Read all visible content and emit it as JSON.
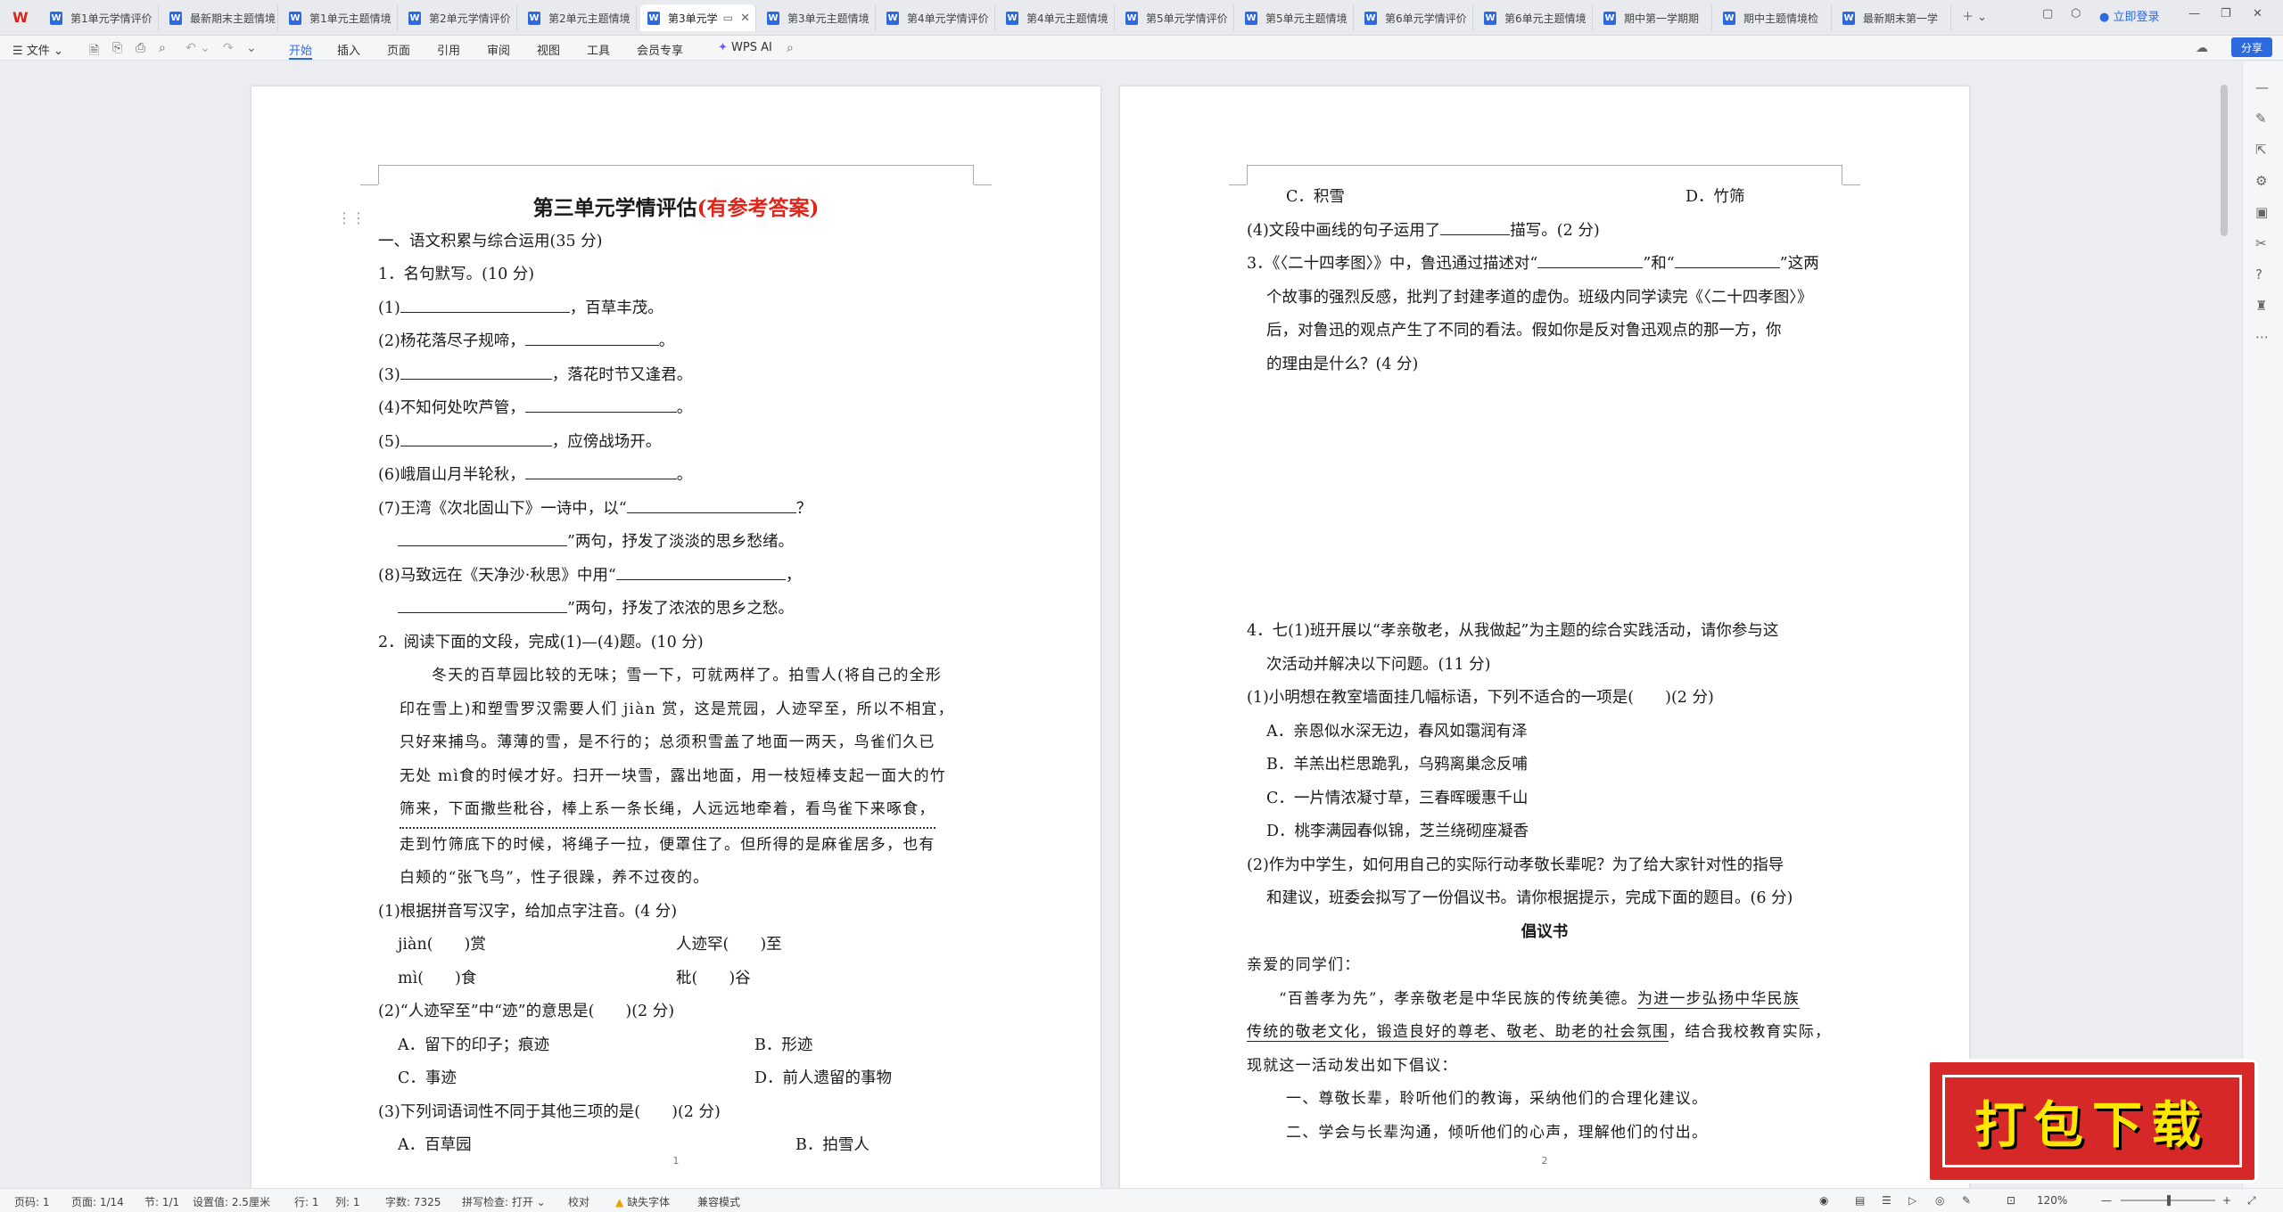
{
  "tabs": [
    {
      "label": "第1单元学情评价"
    },
    {
      "label": "最新期末主题情境"
    },
    {
      "label": "第1单元主题情境"
    },
    {
      "label": "第2单元学情评价"
    },
    {
      "label": "第2单元主题情境"
    },
    {
      "label": "第3单元学",
      "active": true
    },
    {
      "label": "第3单元主题情境"
    },
    {
      "label": "第4单元学情评价"
    },
    {
      "label": "第4单元主题情境"
    },
    {
      "label": "第5单元学情评价"
    },
    {
      "label": "第5单元主题情境"
    },
    {
      "label": "第6单元学情评价"
    },
    {
      "label": "第6单元主题情境"
    },
    {
      "label": "期中第一学期期"
    },
    {
      "label": "期中主题情境检"
    },
    {
      "label": "最新期末第一学"
    }
  ],
  "tabbar": {
    "login": "立即登录"
  },
  "menu": {
    "file": "文件",
    "items": [
      "开始",
      "插入",
      "页面",
      "引用",
      "审阅",
      "视图",
      "工具",
      "会员专享"
    ],
    "wps_ai": "WPS AI",
    "share": "分享"
  },
  "page1": {
    "title_black": "第三单元学情评估",
    "title_red": "(有参考答案)",
    "section1": "一、语文积累与综合运用(35 分)",
    "q1": "1．名句默写。(10 分)",
    "q1_items": [
      {
        "pre": "(1)",
        "post": "，百草丰茂。",
        "blank": 190,
        "blankFirst": true
      },
      {
        "pre": "(2)杨花落尽子规啼，",
        "post": "。",
        "blank": 150
      },
      {
        "pre": "(3)",
        "post": "，落花时节又逢君。",
        "blank": 170,
        "blankFirst": true
      },
      {
        "pre": "(4)不知何处吹芦管，",
        "post": "。",
        "blank": 170
      },
      {
        "pre": "(5)",
        "post": "，应傍战场开。",
        "blank": 170,
        "blankFirst": true
      },
      {
        "pre": "(6)峨眉山月半轮秋，",
        "post": "。",
        "blank": 170
      }
    ],
    "q1_7a": "(7)王湾《次北固山下》一诗中，以“",
    "q1_7b": "？",
    "q1_7c": "”两句，抒发了淡淡的思乡愁绪。",
    "q1_8a": "(8)马致远在《天净沙·秋思》中用“",
    "q1_8b": "，",
    "q1_8c": "”两句，抒发了浓浓的思乡之愁。",
    "q2": "2．阅读下面的文段，完成(1)—(4)题。(10 分)",
    "passage": [
      "冬天的百草园比较的无味；雪一下，可就两样了。拍雪人(将自己的全形",
      "印在雪上)和塑雪罗汉需要人们 jiàn 赏，这是荒园，人迹罕至，所以不相宜，",
      "只好来捕鸟。薄薄的雪，是不行的；总须积雪盖了地面一两天，鸟雀们久已",
      "无处 mì食的时候才好。扫开一块雪，露出地面，用一枝短棒支起一面大的竹",
      "筛来，下面撒些秕谷，棒上系一条长绳，人远远地牵着，看鸟雀下来啄食，",
      "走到竹筛底下的时候，将绳子一拉，便罩住了。但所得的是麻雀居多，也有",
      "白颊的“张飞鸟”，性子很躁，养不过夜的。"
    ],
    "q2_1": "(1)根据拼音写汉字，给加点字注音。(4 分)",
    "q2_1_a": "jiàn(　　)赏",
    "q2_1_b": "人迹罕(　　)至",
    "q2_1_c": "mì(　　)食",
    "q2_1_d": "秕(　　)谷",
    "q2_2": "(2)“人迹罕至”中“迹”的意思是(　　)(2 分)",
    "q2_2_A": "A．留下的印子；痕迹",
    "q2_2_B": "B．形迹",
    "q2_2_C": "C．事迹",
    "q2_2_D": "D．前人遗留的事物",
    "q2_3": "(3)下列词语词性不同于其他三项的是(　　)(2 分)",
    "q2_3_A": "A．百草园",
    "q2_3_B": "B．拍雪人",
    "page_number": "1"
  },
  "page2": {
    "opt_C": "C．积雪",
    "opt_D": "D．竹筛",
    "q2_4a": "(4)文段中画线的句子运用了",
    "q2_4b": "描写。(2 分)",
    "q3_l1a": "3．《〈二十四孝图〉》中，鲁迅通过描述对“",
    "q3_l1b": "”和“",
    "q3_l1c": "”这两",
    "q3_l2": "个故事的强烈反感，批判了封建孝道的虚伪。班级内同学读完《〈二十四孝图〉》",
    "q3_l3": "后，对鲁迅的观点产生了不同的看法。假如你是反对鲁迅观点的那一方，你",
    "q3_l4": "的理由是什么？(4 分)",
    "q4_l1": "4．七(1)班开展以“孝亲敬老，从我做起”为主题的综合实践活动，请你参与这",
    "q4_l2": "次活动并解决以下问题。(11 分)",
    "q4_1": "(1)小明想在教室墙面挂几幅标语，下列不适合的一项是(　　)(2 分)",
    "q4_1_opts": [
      "A．亲恩似水深无边，春风如霭润有泽",
      "B．羊羔出栏思跪乳，乌鸦离巢念反哺",
      "C．一片情浓凝寸草，三春晖暖惠千山",
      "D．桃李满园春似锦，芝兰绕砌座凝香"
    ],
    "q4_2_l1": "(2)作为中学生，如何用自己的实际行动孝敬长辈呢？为了给大家针对性的指导",
    "q4_2_l2": "和建议，班委会拟写了一份倡议书。请你根据提示，完成下面的题目。(6 分)",
    "letter_title": "倡议书",
    "salutation": "亲爱的同学们：",
    "letter_l1a": "“百善孝为先”，孝亲敬老是中华民族的传统美德。",
    "letter_l1b": "为进一步弘扬中华民族",
    "letter_l2a": "传统的敬老文化，锻造良好的尊老、敬老、助老的社会氛围",
    "letter_l2b": "，结合我校教育实际，",
    "letter_l3": "现就这一活动发出如下倡议：",
    "letter_l4": "一、尊敬长辈，聆听他们的教诲，采纳他们的合理化建议。",
    "letter_l5": "二、学会与长辈沟通，倾听他们的心声，理解他们的付出。",
    "page_number": "2"
  },
  "status": {
    "page": "页码: 1",
    "pages": "页面: 1/14",
    "section": "节: 1/1",
    "setting": "设置值: 2.5厘米",
    "row": "行: 1",
    "col": "列: 1",
    "words": "字数: 7325",
    "spell": "拼写检查: 打开",
    "proof": "校对",
    "font_missing": "缺失字体",
    "compat": "兼容模式",
    "zoom": "120%"
  },
  "badge": {
    "text": "打包下载"
  }
}
